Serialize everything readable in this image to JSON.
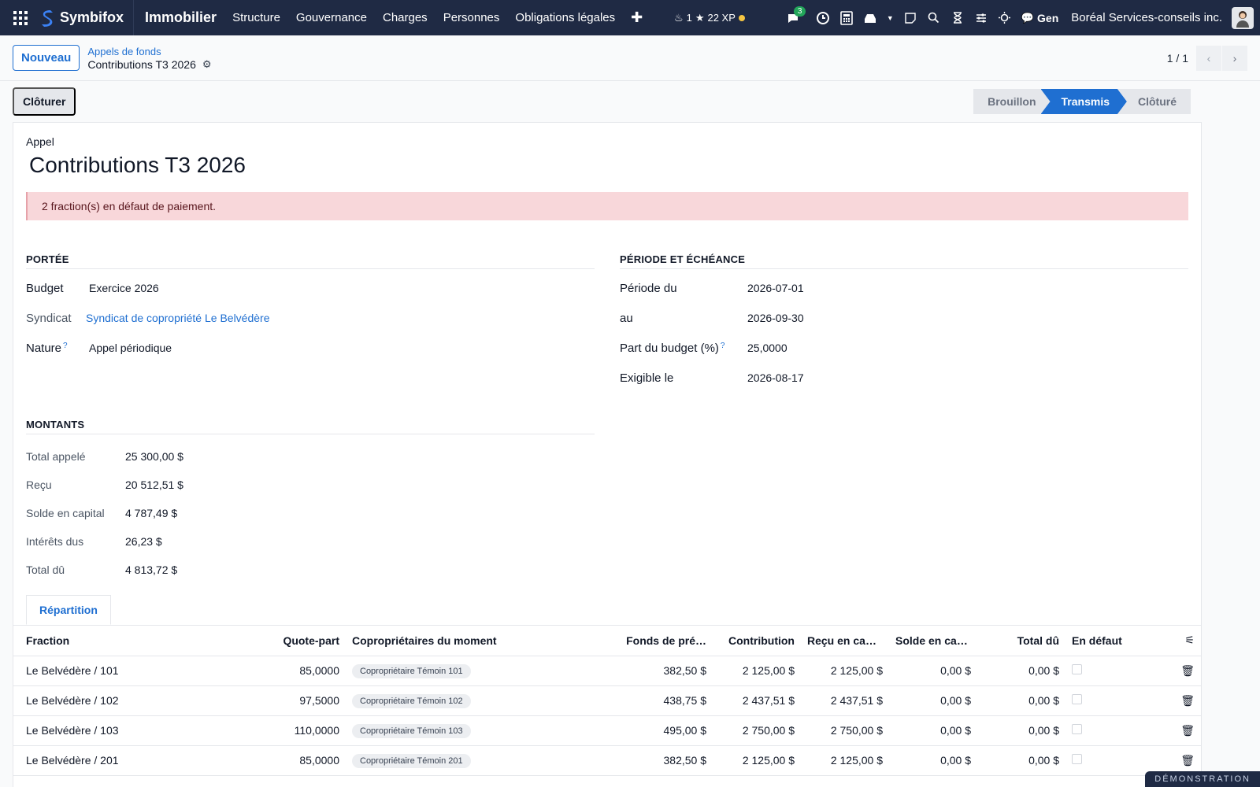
{
  "navbar": {
    "brand": "Symbifox",
    "app": "Immobilier",
    "menu": [
      "Structure",
      "Gouvernance",
      "Charges",
      "Personnes",
      "Obligations légales"
    ],
    "gamify": "1",
    "xp": "22 XP",
    "chat_count": "3",
    "gen": "Gen",
    "company": "Boréal Services-conseils inc."
  },
  "control": {
    "new_label": "Nouveau",
    "breadcrumb_parent": "Appels de fonds",
    "breadcrumb_current": "Contributions T3 2026",
    "pager": "1 / 1"
  },
  "statusbar": {
    "close_label": "Clôturer",
    "stages": [
      "Brouillon",
      "Transmis",
      "Clôturé"
    ],
    "active_stage": "Transmis"
  },
  "form": {
    "kind_label": "Appel",
    "title": "Contributions T3 2026",
    "alert": "2 fraction(s) en défaut de paiement.",
    "scope": {
      "title": "PORTÉE",
      "budget_label": "Budget",
      "budget_value": "Exercice 2026",
      "syndicat_label": "Syndicat",
      "syndicat_value": "Syndicat de copropriété Le Belvédère",
      "nature_label": "Nature",
      "nature_value": "Appel périodique"
    },
    "period": {
      "title": "PÉRIODE ET ÉCHÉANCE",
      "from_label": "Période du",
      "from_value": "2026-07-01",
      "to_label": "au",
      "to_value": "2026-09-30",
      "share_label": "Part du budget (%)",
      "share_value": "25,0000",
      "due_label": "Exigible le",
      "due_value": "2026-08-17"
    },
    "amounts": {
      "title": "MONTANTS",
      "rows": [
        {
          "label": "Total appelé",
          "value": "25 300,00 $"
        },
        {
          "label": "Reçu",
          "value": "20 512,51 $"
        },
        {
          "label": "Solde en capital",
          "value": "4 787,49 $"
        },
        {
          "label": "Intérêts dus",
          "value": "26,23 $"
        },
        {
          "label": "Total dû",
          "value": "4 813,72 $"
        }
      ]
    },
    "tab": "Répartition"
  },
  "table": {
    "headers": [
      "Fraction",
      "Quote-part",
      "Copropriétaires du moment",
      "Fonds de pré…",
      "Contribution",
      "Reçu en capi…",
      "Solde en cap…",
      "Total dû",
      "En défaut"
    ],
    "rows": [
      {
        "fraction": "Le Belvédère / 101",
        "quote": "85,0000",
        "owner": "Copropriétaire Témoin 101",
        "fonds": "382,50 $",
        "contribution": "2 125,00 $",
        "recu": "2 125,00 $",
        "solde": "0,00 $",
        "total": "0,00 $",
        "defaut": false
      },
      {
        "fraction": "Le Belvédère / 102",
        "quote": "97,5000",
        "owner": "Copropriétaire Témoin 102",
        "fonds": "438,75 $",
        "contribution": "2 437,51 $",
        "recu": "2 437,51 $",
        "solde": "0,00 $",
        "total": "0,00 $",
        "defaut": false
      },
      {
        "fraction": "Le Belvédère / 103",
        "quote": "110,0000",
        "owner": "Copropriétaire Témoin 103",
        "fonds": "495,00 $",
        "contribution": "2 750,00 $",
        "recu": "2 750,00 $",
        "solde": "0,00 $",
        "total": "0,00 $",
        "defaut": false
      },
      {
        "fraction": "Le Belvédère / 201",
        "quote": "85,0000",
        "owner": "Copropriétaire Témoin 201",
        "fonds": "382,50 $",
        "contribution": "2 125,00 $",
        "recu": "2 125,00 $",
        "solde": "0,00 $",
        "total": "0,00 $",
        "defaut": false
      }
    ]
  },
  "ribbon": "DÉMONSTRATION",
  "colors": {
    "navbar": "#1f2a44",
    "accent": "#1f6fd1",
    "alert_bg": "#f8d7da"
  }
}
